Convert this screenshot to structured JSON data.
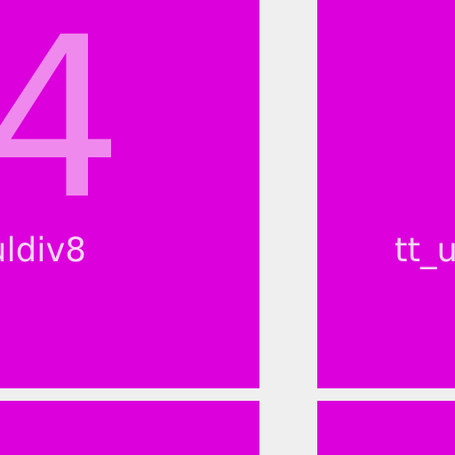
{
  "tiles": {
    "top_left": {
      "number": "4",
      "label": "uldiv8"
    },
    "top_right": {
      "label": "tt_u"
    }
  },
  "colors": {
    "tile_background": "#dc00dc",
    "page_background": "#efefef",
    "number_text": "#f089ed",
    "label_text": "#f6d6f5"
  }
}
